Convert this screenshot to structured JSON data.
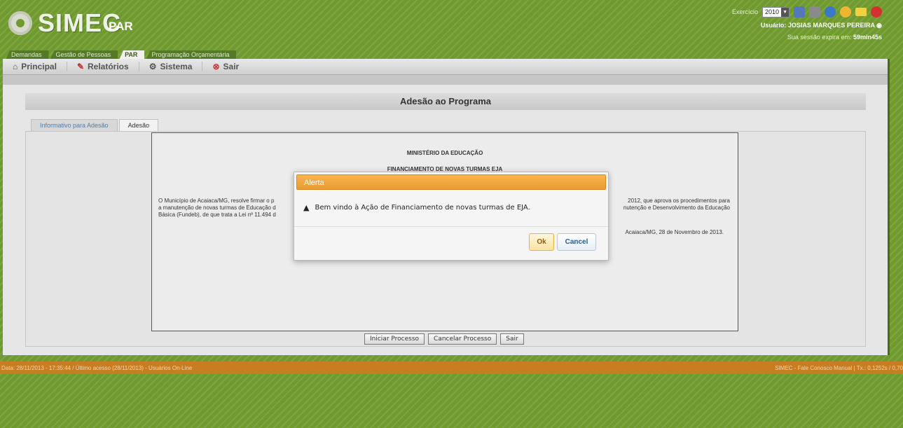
{
  "header": {
    "logo_text": "SIMEC",
    "system_name": "PAR",
    "year_label": "Exercício",
    "year_value": "2010",
    "user_label": "Usuário:",
    "user_name": "JOSIAS MARQUES PEREIRA",
    "session_text": "Sua sessão expira em:",
    "session_time": "59min45s"
  },
  "module_tabs": [
    {
      "label": "Demandas"
    },
    {
      "label": "Gestão de Pessoas"
    },
    {
      "label": "PAR"
    },
    {
      "label": "Programação Orçamentária"
    }
  ],
  "menu": [
    {
      "label": "Principal",
      "icon": "home-icon"
    },
    {
      "label": "Relatórios",
      "icon": "report-icon"
    },
    {
      "label": "Sistema",
      "icon": "system-icon"
    },
    {
      "label": "Sair",
      "icon": "exit-icon"
    }
  ],
  "panel": {
    "title": "Adesão ao Programa",
    "tabs": [
      {
        "label": "Informativo para Adesão"
      },
      {
        "label": "Adesão"
      }
    ]
  },
  "document": {
    "heading1": "MINISTÉRIO DA EDUCAÇÃO",
    "heading2": "FINANCIAMENTO DE NOVAS TURMAS EJA",
    "body_left": "O Município de Acaiaca/MG, resolve firmar o p",
    "body_left2": "a manutenção de novas turmas de Educação d",
    "body_left3": "Básica (Fundeb), de que trata a Lei nº 11.494 d",
    "body_right": "2012, que aprova os procedimentos para",
    "body_right2": "nutenção e Desenvolvimento da Educação",
    "date": "Acaiaca/MG, 28 de Novembro de 2013."
  },
  "buttons": {
    "start": "Iniciar Processo",
    "cancel": "Cancelar Processo",
    "exit": "Sair"
  },
  "footer": {
    "left": "Data: 28/11/2013 - 17:35:44 / Último acesso (28/11/2013) - Usuários On-Line",
    "right": "SIMEC - Fale Conosco Manual  | Tx.: 0,1252s / 0,70"
  },
  "modal": {
    "title": "Alerta",
    "message": "Bem vindo à Ação de Financiamento de novas turmas de EJA.",
    "ok": "Ok",
    "cancel": "Cancel"
  },
  "colors": {
    "background": "#6f9a2e",
    "footer": "#c97d22",
    "modal_header": "#ec9b2d"
  }
}
